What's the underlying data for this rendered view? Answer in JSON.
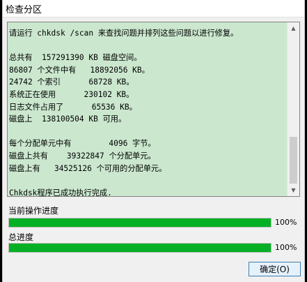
{
  "window": {
    "title": "检查分区"
  },
  "log": {
    "lines": [
      "请运行 chkdsk /scan 来查找问题并排列这些问题以进行修复。",
      "",
      "总共有  157291390 KB 磁盘空间。",
      "86807 个文件中有   18892056 KB。",
      "24742 个索引      68728 KB。",
      "系统正在使用      230102 KB。",
      "日志文件占用了      65536 KB。",
      "磁盘上  138100504 KB 可用。",
      "",
      "每个分配单元中有        4096 字节。",
      "磁盘上共有    39322847 个分配单元。",
      "磁盘上有   34525126 个可用的分配单元。",
      "",
      "Chkdsk程序已成功执行完成."
    ]
  },
  "progress": {
    "current": {
      "label": "当前操作进度",
      "value": 1.0,
      "percent_text": "100%"
    },
    "total": {
      "label": "总进度",
      "value": 1.0,
      "percent_text": "100%"
    }
  },
  "buttons": {
    "ok_label": "确定(O)"
  },
  "colors": {
    "log_background": "#cbe8cf",
    "progress_fill": "#06b025"
  }
}
